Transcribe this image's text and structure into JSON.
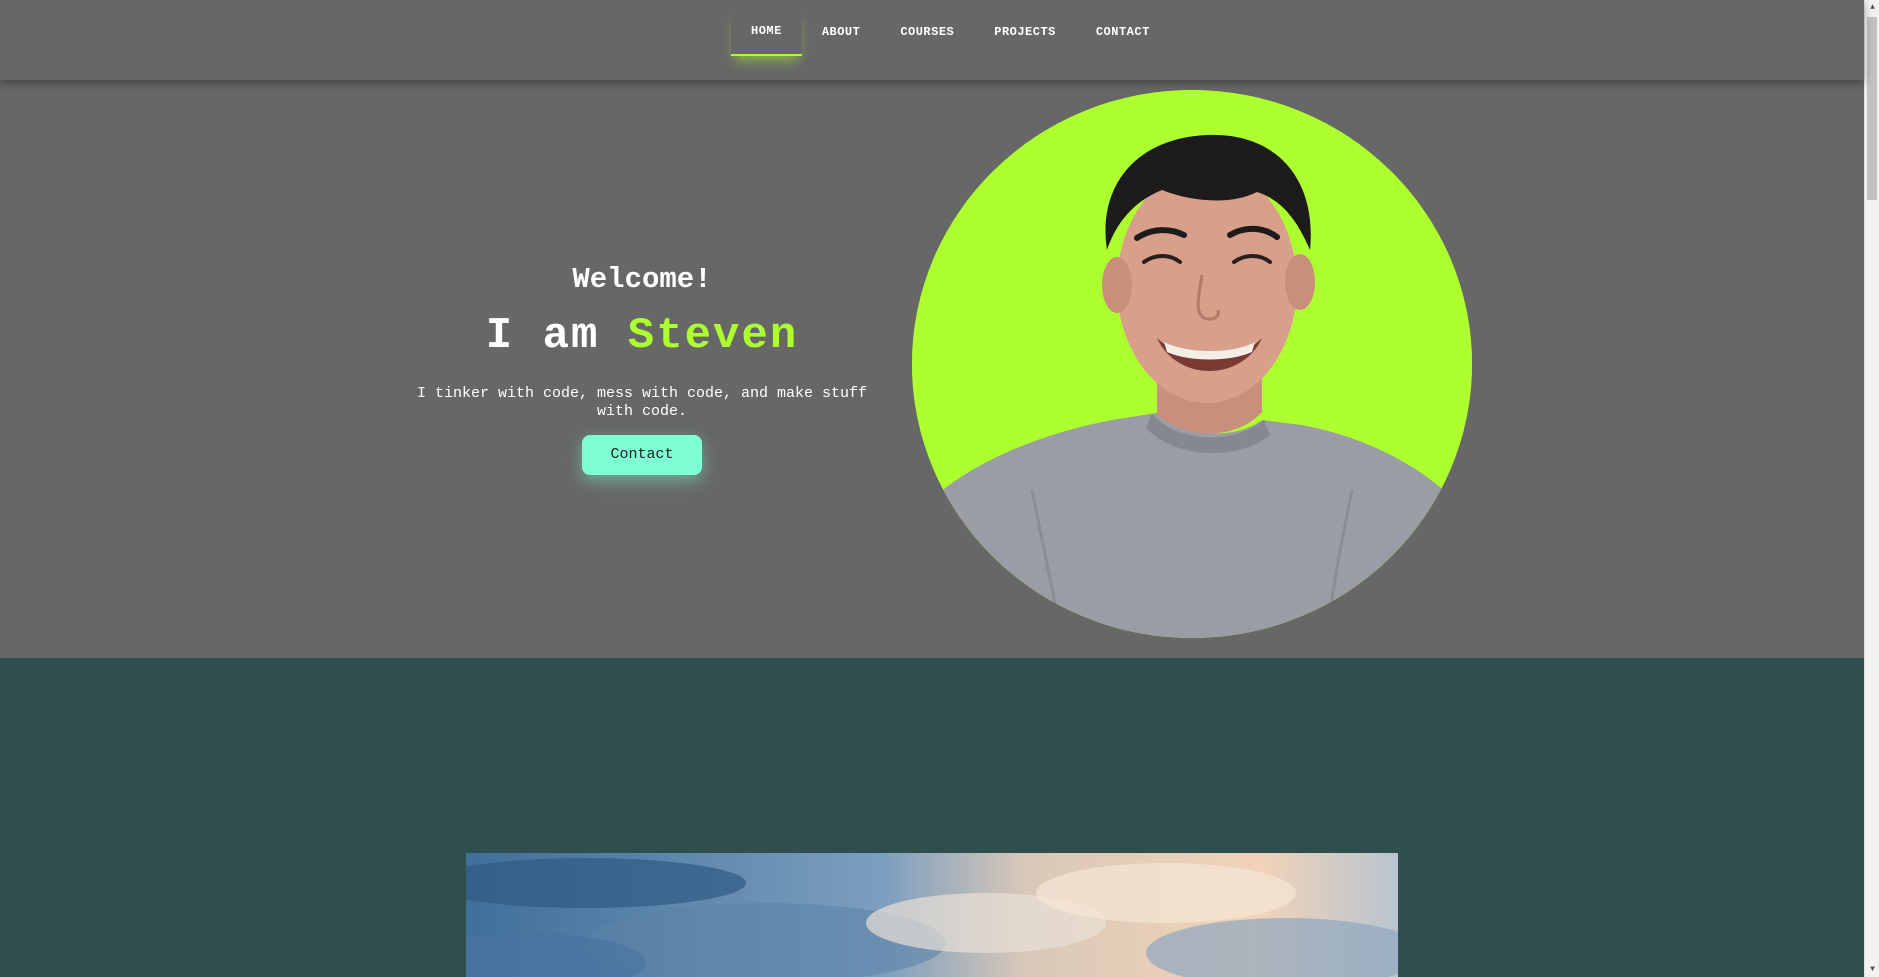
{
  "nav": {
    "items": [
      {
        "label": "HOME",
        "active": true
      },
      {
        "label": "ABOUT",
        "active": false
      },
      {
        "label": "COURSES",
        "active": false
      },
      {
        "label": "PROJECTS",
        "active": false
      },
      {
        "label": "CONTACT",
        "active": false
      }
    ]
  },
  "hero": {
    "welcome": "Welcome!",
    "intro_prefix": "I am ",
    "intro_name": "Steven",
    "tagline_line1": "I tinker with code, mess with code, and make stuff",
    "tagline_line2": "with code.",
    "contact_button": "Contact",
    "avatar_icon": "profile-photo"
  },
  "colors": {
    "background": "#676767",
    "accent": "#adff2f",
    "button": "#7fffd4",
    "section_two": "#2f4f4f"
  },
  "section_two": {
    "image_icon": "sky-clouds-image"
  }
}
